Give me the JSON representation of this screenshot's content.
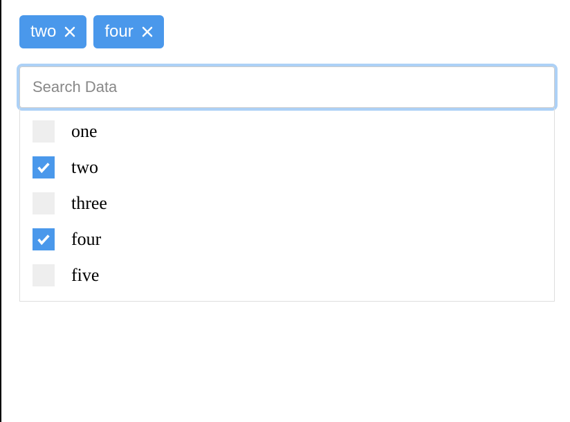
{
  "colors": {
    "accent": "#4A98EB"
  },
  "chips": [
    {
      "label": "two"
    },
    {
      "label": "four"
    }
  ],
  "search": {
    "placeholder": "Search Data",
    "value": ""
  },
  "options": [
    {
      "label": "one",
      "checked": false
    },
    {
      "label": "two",
      "checked": true
    },
    {
      "label": "three",
      "checked": false
    },
    {
      "label": "four",
      "checked": true
    },
    {
      "label": "five",
      "checked": false
    }
  ]
}
